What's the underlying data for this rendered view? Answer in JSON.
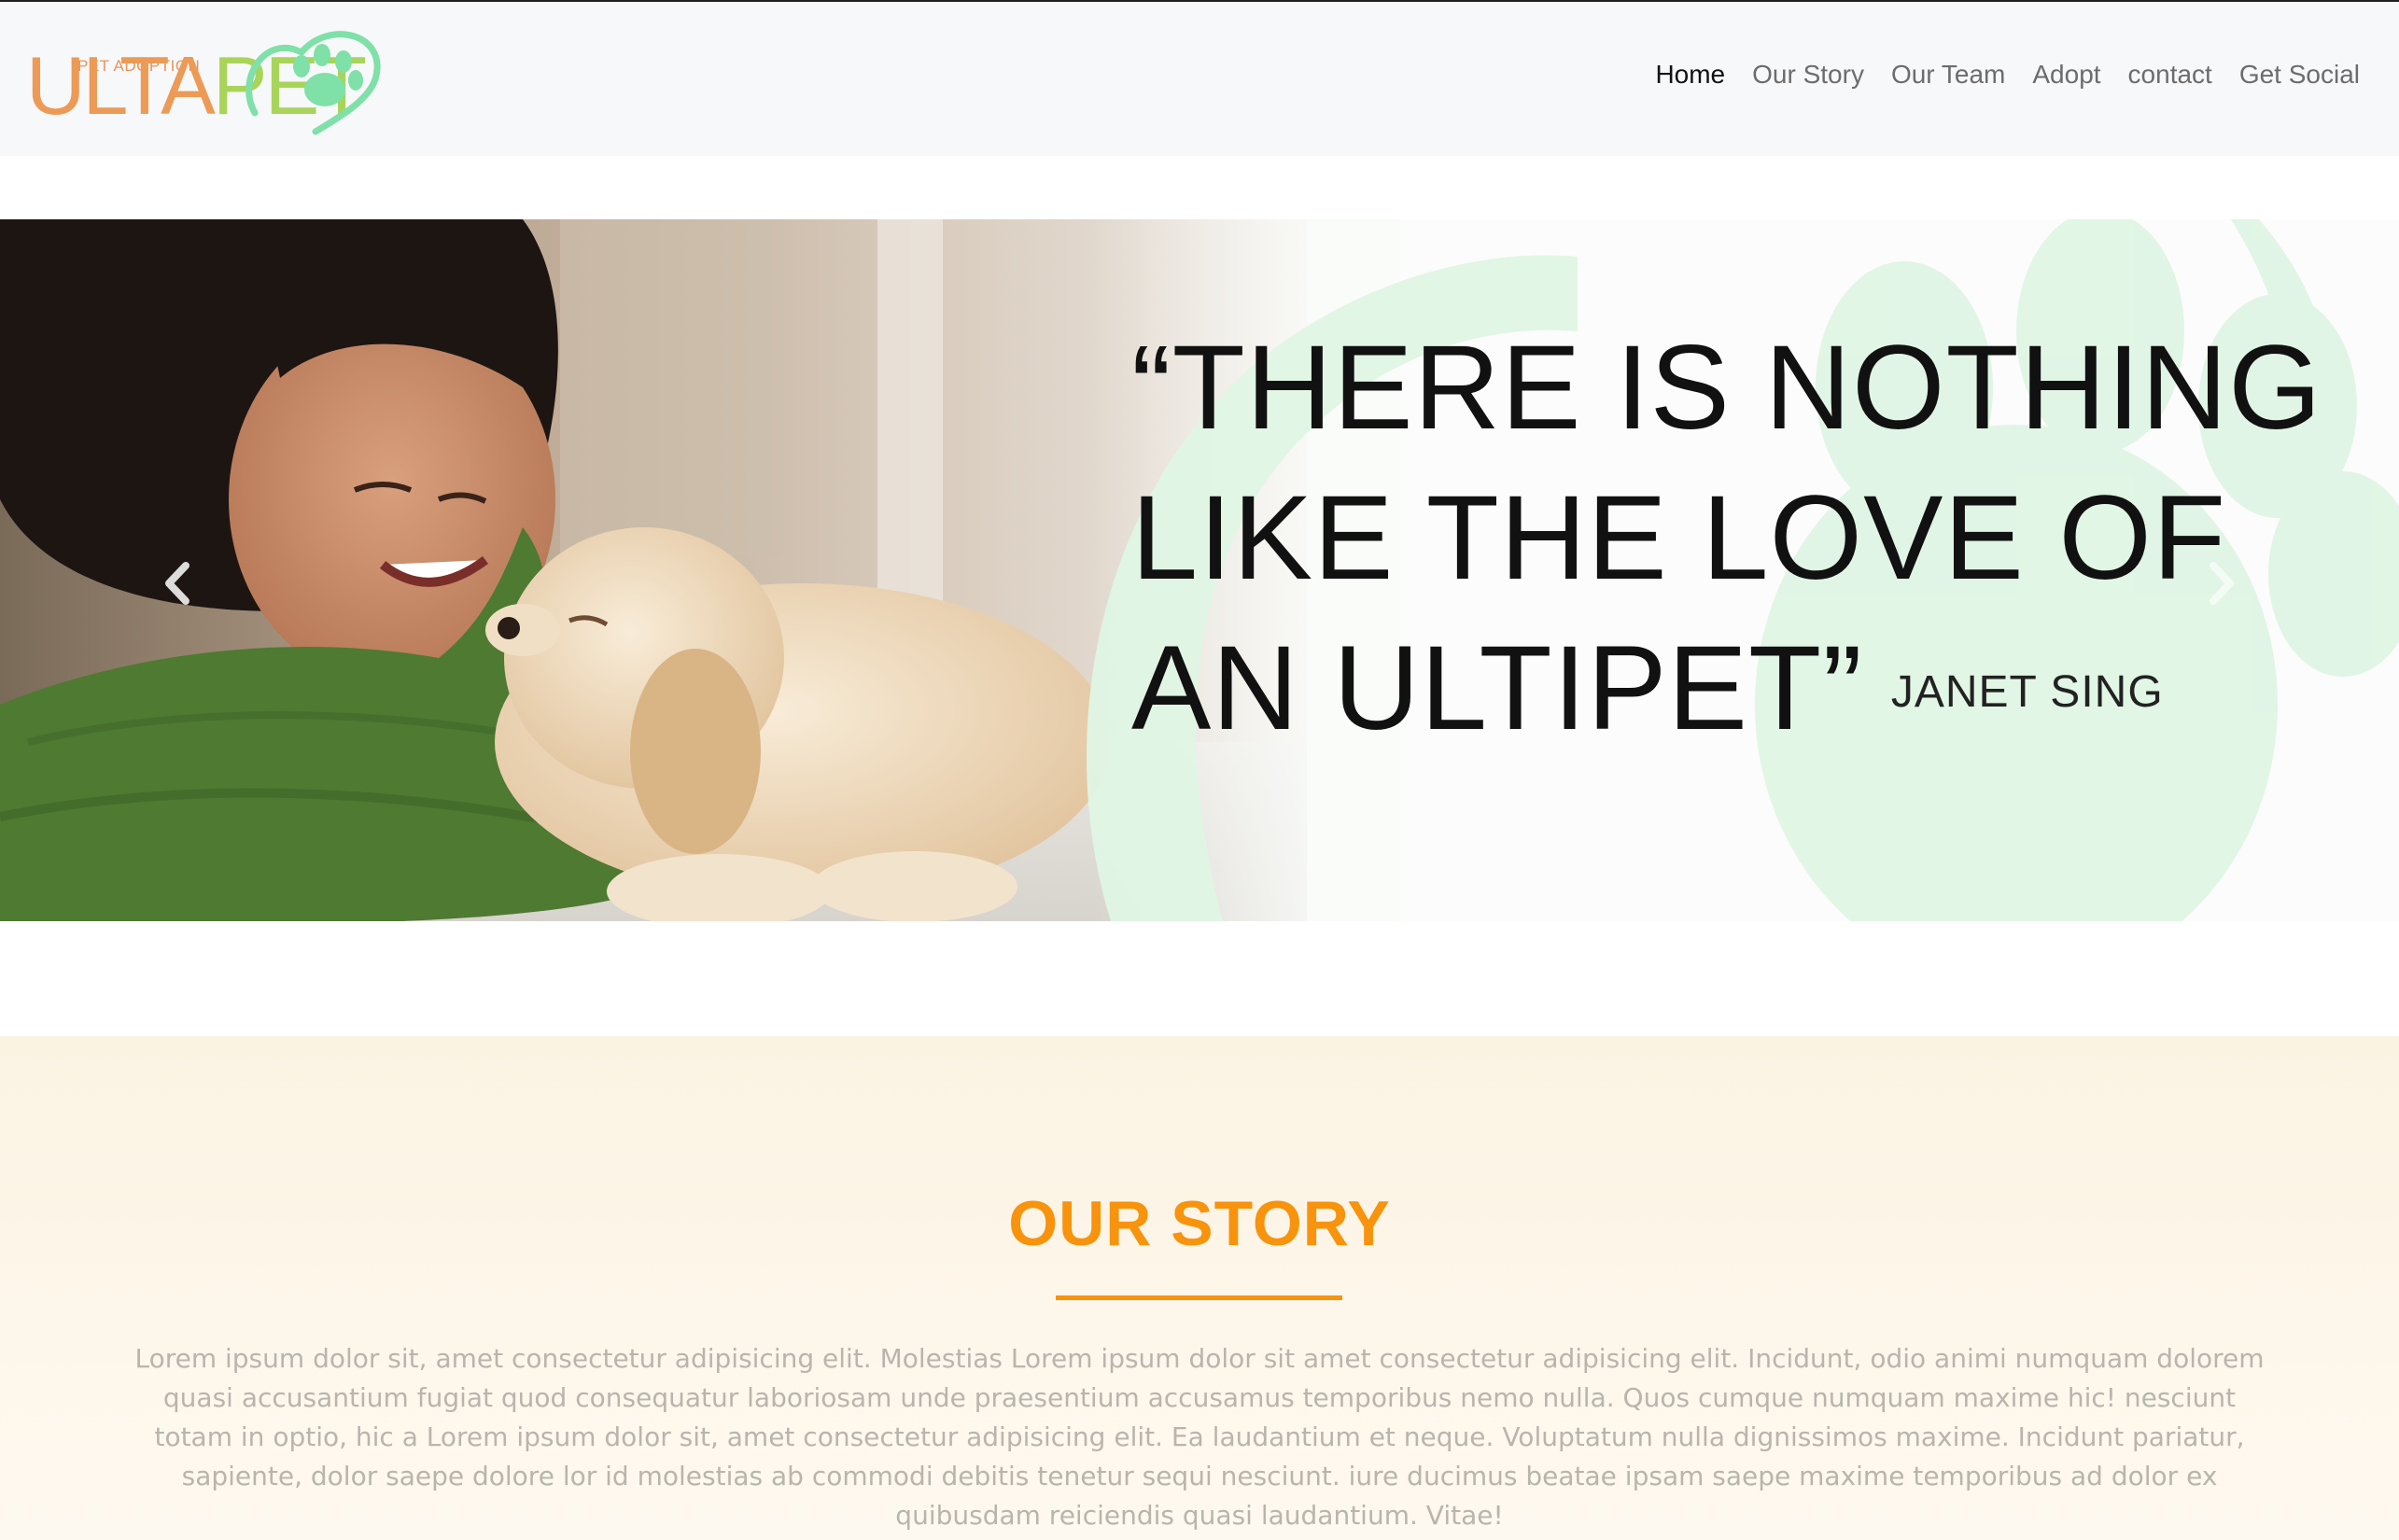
{
  "brand": {
    "logo_small_text": "PET ADOPTION",
    "logo_word_part1": "ULTA",
    "logo_word_part2": "PET",
    "colors": {
      "orange": "#ec9a56",
      "green": "#a9d45a",
      "mint": "#7fe0a8"
    }
  },
  "nav": {
    "items": [
      {
        "label": "Home",
        "active": true
      },
      {
        "label": "Our Story",
        "active": false
      },
      {
        "label": "Our Team",
        "active": false
      },
      {
        "label": "Adopt",
        "active": false
      },
      {
        "label": "contact",
        "active": false
      },
      {
        "label": "Get Social",
        "active": false
      }
    ]
  },
  "hero": {
    "quote_lines": [
      "“THERE IS NOTHING",
      "LIKE THE LOVE OF",
      "AN ULTIPET”"
    ],
    "author": "JANET SING",
    "prev_icon": "chevron-left-icon",
    "next_icon": "chevron-right-icon"
  },
  "story": {
    "title": "OUR STORY",
    "accent_color": "#f7930c",
    "body": "Lorem ipsum dolor sit, amet consectetur adipisicing elit. Molestias Lorem ipsum dolor sit amet consectetur adipisicing elit. Incidunt, odio animi numquam dolorem quasi accusantium fugiat quod consequatur laboriosam unde praesentium accusamus temporibus nemo nulla. Quos cumque numquam maxime hic! nesciunt totam in optio, hic a Lorem ipsum dolor sit, amet consectetur adipisicing elit. Ea laudantium et neque. Voluptatum nulla dignissimos maxime. Incidunt pariatur, sapiente, dolor saepe dolore lor id molestias ab commodi debitis tenetur sequi nesciunt. iure ducimus beatae ipsam saepe maxime temporibus ad dolor ex quibusdam reiciendis quasi laudantium. Vitae!"
  }
}
